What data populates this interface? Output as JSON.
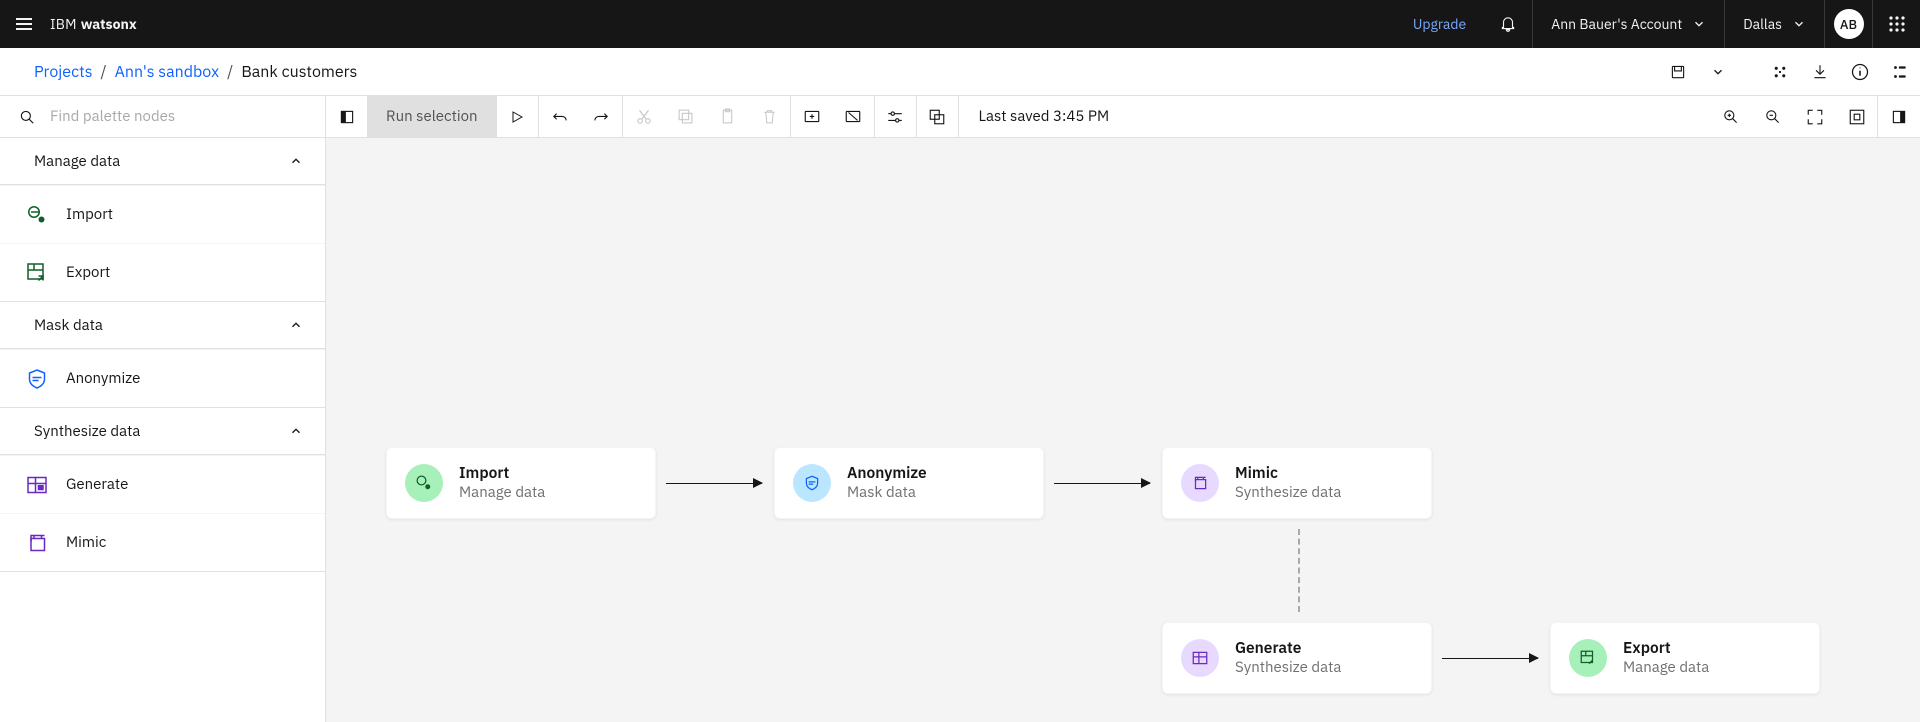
{
  "header": {
    "brand_ibm": "IBM",
    "brand_product": "watsonx",
    "upgrade": "Upgrade",
    "account": "Ann Bauer's Account",
    "region": "Dallas",
    "avatar": "AB"
  },
  "breadcrumbs": {
    "root": "Projects",
    "project": "Ann's sandbox",
    "current": "Bank customers"
  },
  "toolbar": {
    "search_placeholder": "Find palette nodes",
    "run_selection": "Run selection",
    "status": "Last saved 3:45 PM"
  },
  "palette": {
    "sections": [
      {
        "title": "Manage data",
        "items": [
          {
            "label": "Import"
          },
          {
            "label": "Export"
          }
        ]
      },
      {
        "title": "Mask data",
        "items": [
          {
            "label": "Anonymize"
          }
        ]
      },
      {
        "title": "Synthesize data",
        "items": [
          {
            "label": "Generate"
          },
          {
            "label": "Mimic"
          }
        ]
      }
    ]
  },
  "canvas": {
    "nodes": [
      {
        "title": "Import",
        "sub": "Manage data"
      },
      {
        "title": "Anonymize",
        "sub": "Mask data"
      },
      {
        "title": "Mimic",
        "sub": "Synthesize data"
      },
      {
        "title": "Generate",
        "sub": "Synthesize data"
      },
      {
        "title": "Export",
        "sub": "Manage data"
      }
    ]
  }
}
